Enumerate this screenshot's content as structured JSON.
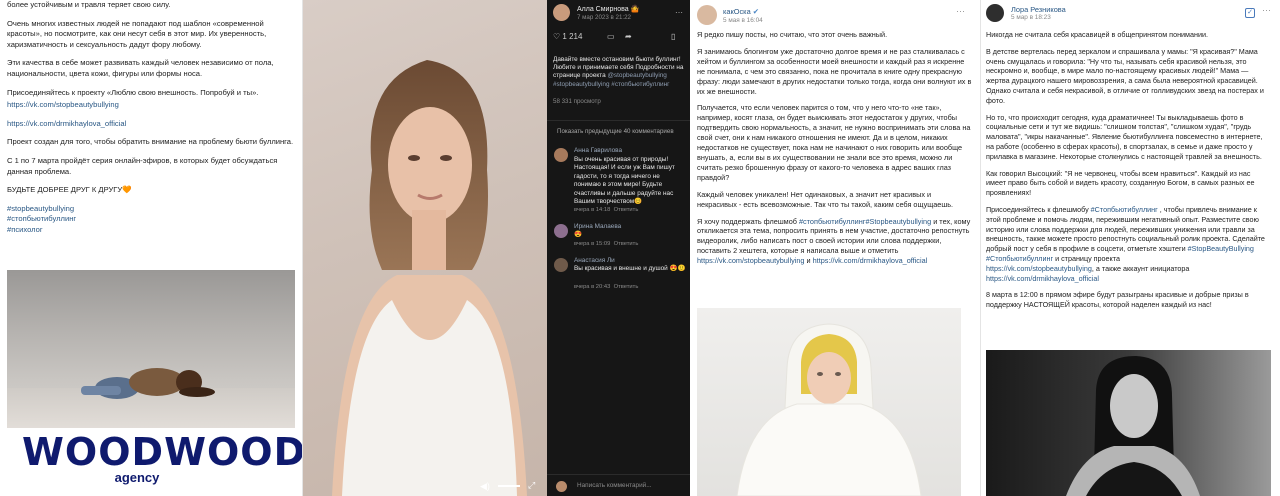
{
  "panel1": {
    "p1": "более устойчивым и травля теряет свою силу.",
    "p2": "Очень многих известных людей не попадают под шаблон «современной красоты», но посмотрите, как они несут себя в этот мир. Их уверенность, харизматичность и сексуальность дадут фору любому.",
    "p3": "Эти качества в себе может развивать каждый человек независимо от пола, национальности, цвета кожи, фигуры или формы носа.",
    "p4": "Присоединяйтесь к проекту «Люблю свою внешность. Попробуй и ты».",
    "link1": "https://vk.com/stopbeautybullying",
    "link2": "https://vk.com/drmikhaylova_official",
    "p5": "Проект создан для того, чтобы обратить внимание на проблему бьюти буллинга.",
    "p6": "С 1 по 7 марта пройдёт серия онлайн-эфиров, в которых будет обсуждаться данная проблема.",
    "p7": "БУДЬТЕ ДОБРЕЕ ДРУГ К ДРУГУ🧡",
    "tags": [
      "#stopbeautybullying",
      "#стопбьютибуллинг",
      "#психолог"
    ],
    "logo_word": "WOODWOOD",
    "logo_agency": "agency"
  },
  "panel3": {
    "author": "Алла Смирнова 🤷",
    "date": "7 мар 2023 в 21:22",
    "likes": "1 214",
    "post": "Давайте вместе остановим бьюти буллинг! Любите и принимаете себя Подробности на странице проекта",
    "post_tags": "@stopbeautybullying #stopbeautybullying #стопбьютибуллинг",
    "views": "58 331 просмотр",
    "show_prev": "Показать предыдущие 40 комментариев",
    "comments": [
      {
        "name": "Анна Гаврилова",
        "text": "Вы очень красивая от природы! Настоящая! И если уж Вам пишут гадости, то я тогда ничего не понимаю в этом мире! Будьте счастливы и дальше радуйте нас Вашим творчеством😊",
        "date": "вчера в 14:18",
        "reply": "Ответить"
      },
      {
        "name": "Ирина Малаева",
        "text": "😍",
        "date": "вчера в 15:09",
        "reply": "Ответить"
      },
      {
        "name": "Анастасия Ли",
        "text": "Вы красивая и внешне и душой 😍🙂",
        "date": "вчера в 20:43",
        "reply": "Ответить"
      }
    ],
    "comment_placeholder": "Написать комментарий..."
  },
  "panel4": {
    "author": "какОска",
    "date": "5 мая в 16:04",
    "p1": "Я редко пишу посты, но считаю, что этот очень важный.",
    "p2": "Я занимаюсь блогингом уже достаточно долгое время и не раз сталкивалась с хейтом и буллингом за особенности моей внешности и каждый раз я искренне не понимала, с чем это связанно, пока не прочитала в книге одну прекрасную фразу: люди замечают в других недостатки только тогда, когда они волнуют их в их же внешности.",
    "p3": "Получается, что если человек парится о том, что у него что-то «не так», например, косят глаза, он будет выискивать этот недостаток у других, чтобы подтвердить свою нормальность, а значит, не нужно воспринимать эти слова на свой счет, они к нам никакого отношения не имеют. Да и в целом, никаких недостатков не существует, пока нам не начинают о них говорить или вообще внушать, а, если вы в их существовании не знали все это время, можно ли считать резко брошенную фразу от какого-то человека в адрес ваших глаз правдой?",
    "p4": "Каждый человек уникален! Нет одинаковых, а значит нет красивых и некрасивых - есть всевозможные. Так что ты такой, каким себя ощущаешь.",
    "p5a": "Я хочу поддержать флешмоб ",
    "p5tags": "#стопбьютибуллинг#Stopbeautybullying",
    "p5b": " и тех, кому откликается эта тема, попросить принять в нем участие, достаточно репостнуть видеоролик, либо написать пост о своей истории или слова поддержки,",
    "p6": "поставить 2 хештега, которые я написала выше и отметить",
    "link1": "https://vk.com/stopbeautybullying",
    "and": " и ",
    "link2": "https://vk.com/drmikhaylova_official"
  },
  "panel5": {
    "author": "Лора Резникова",
    "date": "5 мар в 18:23",
    "p1": "Никогда не считала себя красавицей в общепринятом понимании.",
    "p2": "В детстве вертелась перед зеркалом и спрашивала у мамы: \"Я красивая?\" Мама очень смущалась и говорила: \"Ну что ты, называть себя красивой нельзя, это нескромно и, вообще, в мире мало по-настоящему красивых людей!\" Мама — жертва дурацкого нашего мировоззрения, а сама была невероятной красавицей. Однако считала и себя некрасивой, в отличие от голливудских звезд на постерах и фото.",
    "p3": "Но то, что происходит сегодня, куда драматичнее! Ты выкладываешь фото в социальные сети и тут же видишь: \"слишком толстая\", \"слишком худая\", \"грудь маловата\", \"икры накачанные\". Явление бьютибуллинга повсеместно в интернете, на работе (особенно в сферах красоты), в спортзалах, в семье и даже просто у прилавка в магазине. Некоторые столкнулись с настоящей травлей за внешность.",
    "p4": "Как говорил Высоцкий: \"Я не червонец, чтобы всем нравиться\". Каждый из нас имеет право быть собой и видеть красоту, созданную Богом, в самых разных ее проявлениях!",
    "p5a": "Присоединяйтесь к флешмобу ",
    "p5tag": "#Стопбьютибуллинг",
    "p5b": " , чтобы привлечь внимание к этой проблеме и помочь людям, пережившим негативный опыт. Разместите свою историю или слова поддержки для людей, переживших унижения или травли за внешность, также можете просто репостнуть социальный ролик проекта. Сделайте добрый пост у себя в профиле в соцсети, отметьте хэштеги ",
    "p5tags2": "#StopBeautyBullying #Стопбьютибуллинг",
    "p5c": " и страницу проекта",
    "link1": "https://vk.com/stopbeautybullying",
    "p5d": ", а также аккаунт инициатора",
    "link2": "https://vk.com/drmikhaylova_official",
    "p6": "8 марта в 12:00 в прямом эфире будут разыграны красивые и добрые призы в поддержку НАСТОЯЩЕЙ красоты, которой наделен каждый из нас!"
  }
}
